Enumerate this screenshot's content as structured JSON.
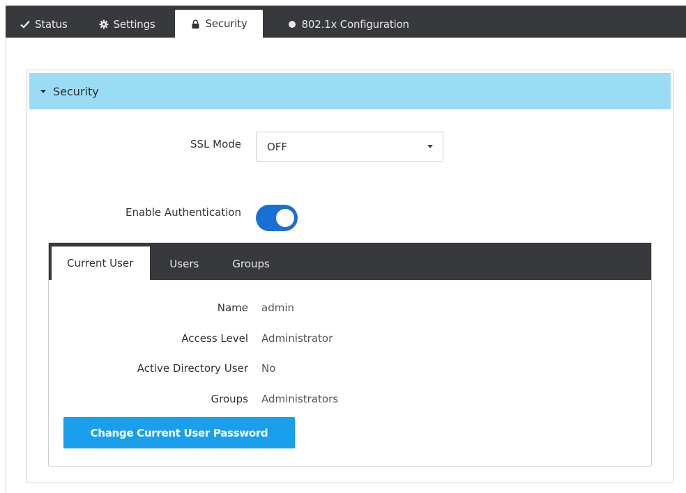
{
  "top_tabs": [
    {
      "label": "Status",
      "icon": "check-icon"
    },
    {
      "label": "Settings",
      "icon": "gear-icon"
    },
    {
      "label": "Security",
      "icon": "lock-icon",
      "active": true
    },
    {
      "label": "802.1x Configuration",
      "icon": "dot-icon"
    }
  ],
  "section": {
    "title": "Security"
  },
  "ssl": {
    "label": "SSL Mode",
    "value": "OFF"
  },
  "auth": {
    "label": "Enable Authentication",
    "enabled": true
  },
  "user_tabs": [
    {
      "label": "Current User",
      "active": true
    },
    {
      "label": "Users"
    },
    {
      "label": "Groups"
    }
  ],
  "current_user": {
    "rows": [
      {
        "key": "Name",
        "value": "admin"
      },
      {
        "key": "Access Level",
        "value": "Administrator"
      },
      {
        "key": "Active Directory User",
        "value": "No"
      },
      {
        "key": "Groups",
        "value": "Administrators"
      }
    ],
    "change_password_label": "Change Current User Password"
  },
  "colors": {
    "tab_bar": "#37393d",
    "section_header": "#9bdcf5",
    "toggle_on": "#1a6fd6",
    "primary_button": "#1a9fed"
  }
}
